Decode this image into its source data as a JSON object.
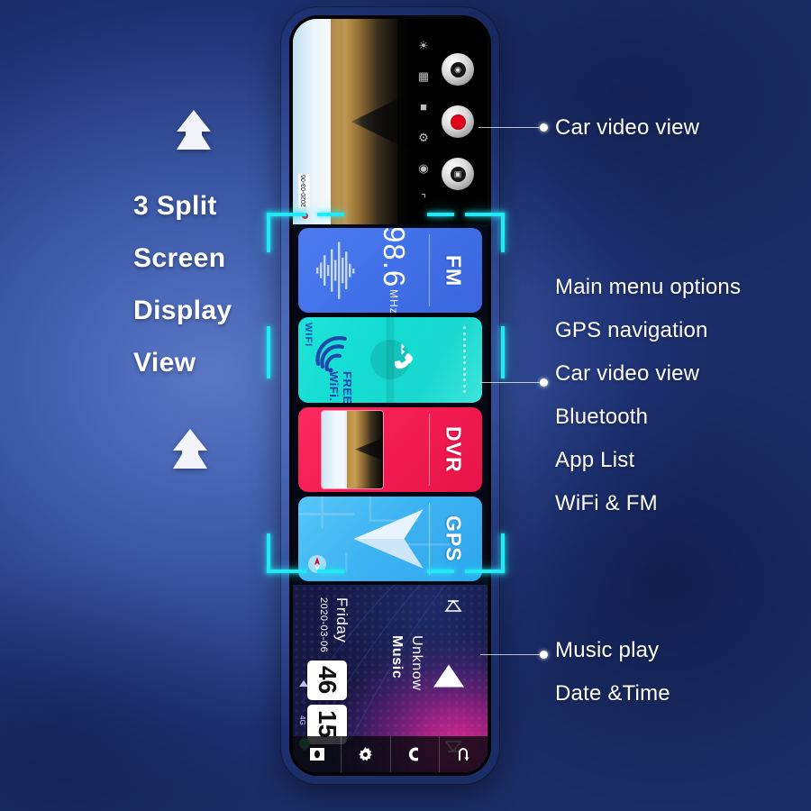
{
  "headline": {
    "lines": [
      "3 Split",
      "Screen",
      "Display",
      "View"
    ]
  },
  "callouts": {
    "top": [
      "Car video view"
    ],
    "middle": [
      "Main menu options",
      "GPS navigation",
      "Car video view",
      "Bluetooth",
      "App List",
      "WiFi & FM"
    ],
    "bottom": [
      "Music play",
      "Date &Time"
    ]
  },
  "device": {
    "camera_view": {
      "icons": [
        "flash-icon",
        "resolution-icon",
        "battery-icon",
        "settings-gear-icon",
        "camera-switch-icon",
        "bracket-icon"
      ],
      "buttons": [
        "photo-capture-button",
        "record-button",
        "gallery-button"
      ],
      "timestamp": "2020-03-06"
    },
    "tiles": [
      {
        "name": "fm",
        "label": "FM",
        "frequency": "98.6",
        "unit": "MHz",
        "color": "#4171e8"
      },
      {
        "name": "wifi-bluetooth",
        "label": "",
        "tag": "WIFI",
        "free_text": "FREE WiFi.",
        "color": "#14dcd2"
      },
      {
        "name": "dvr",
        "label": "DVR",
        "color": "#f21c52"
      },
      {
        "name": "gps",
        "label": "GPS",
        "color": "#3fb4f2"
      }
    ],
    "music": {
      "date": "2020-03-06",
      "weekday": "Friday",
      "hour": "15",
      "minute": "46",
      "track_title": "Music",
      "artist": "Unknow",
      "signal": "4G"
    },
    "navbar": [
      "home-icon",
      "settings-gear-icon",
      "back-icon",
      "return-icon"
    ]
  },
  "colors": {
    "background_dark": "#1b2d66",
    "background_light": "#5a77c4",
    "frame_accent": "#25e8f5",
    "device_bezel": "#c99b86",
    "record_red": "#e2071c"
  }
}
